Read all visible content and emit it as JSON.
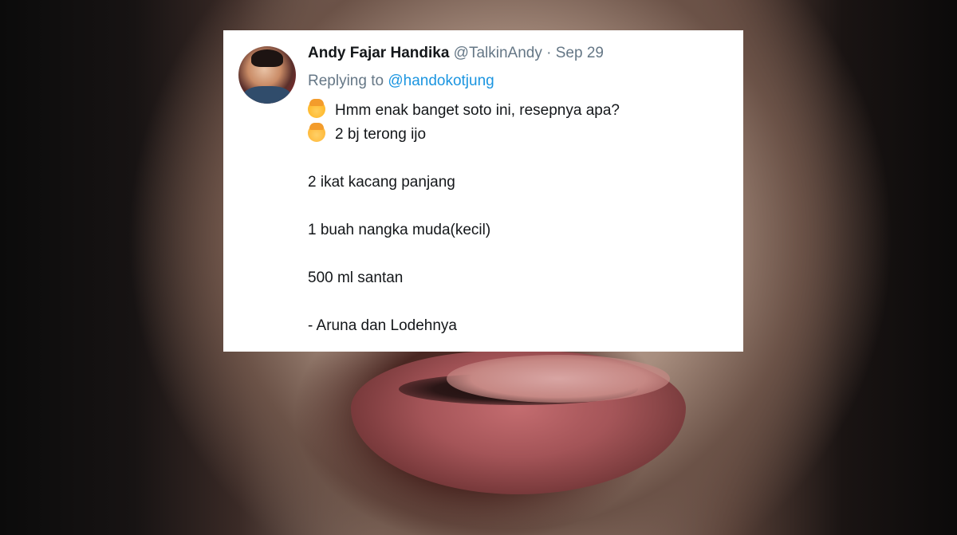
{
  "tweet": {
    "author_name": "Andy Fajar Handika",
    "handle": "@TalkinAndy",
    "separator": "·",
    "date": "Sep 29",
    "replying_prefix": "Replying to",
    "replying_to": "@handokotjung",
    "lines": [
      {
        "emoji": "man-emoji-icon",
        "text": "Hmm enak banget soto ini, resepnya apa?"
      },
      {
        "emoji": "woman-emoji-icon",
        "text": "2 bj terong ijo"
      },
      {
        "text": "2 ikat kacang panjang"
      },
      {
        "text": "1 buah nangka muda(kecil)"
      },
      {
        "text": "500 ml santan"
      },
      {
        "text": "- Aruna dan Lodehnya"
      }
    ]
  },
  "colors": {
    "name": "#14171a",
    "meta": "#657786",
    "mention": "#1b95e0",
    "card": "#ffffff"
  }
}
